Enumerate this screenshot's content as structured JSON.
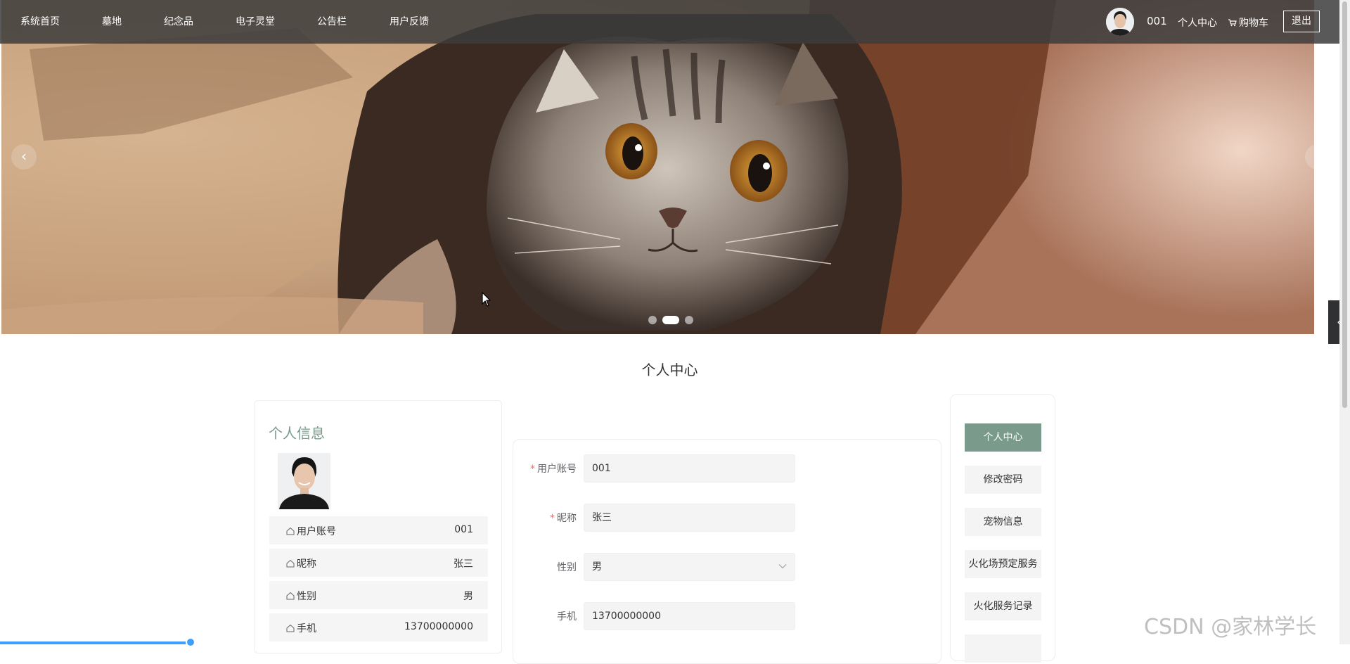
{
  "nav": {
    "items": [
      "系统首页",
      "墓地",
      "纪念品",
      "电子灵堂",
      "公告栏",
      "用户反馈"
    ],
    "username": "001",
    "personal_center": "个人中心",
    "cart": "购物车",
    "logout": "退出"
  },
  "banner": {
    "prev": "‹",
    "next": "›",
    "active_slide": 2,
    "slide_count": 3
  },
  "section_title": "个人中心",
  "info": {
    "title": "个人信息",
    "rows": [
      {
        "label": "用户账号",
        "value": "001"
      },
      {
        "label": "昵称",
        "value": "张三"
      },
      {
        "label": "性别",
        "value": "男"
      },
      {
        "label": "手机",
        "value": "13700000000"
      }
    ]
  },
  "form": {
    "fields": [
      {
        "label": "用户账号",
        "value": "001",
        "required": true
      },
      {
        "label": "昵称",
        "value": "张三",
        "required": true
      },
      {
        "label": "性别",
        "value": "男",
        "required": false
      },
      {
        "label": "手机",
        "value": "13700000000",
        "required": false
      }
    ]
  },
  "menu": {
    "items": [
      "个人中心",
      "修改密码",
      "宠物信息",
      "火化场预定服务",
      "火化服务记录"
    ],
    "active": 0
  },
  "side_tab": "‹",
  "watermark": "CSDN @家林学长",
  "colors": {
    "accent": "#7a9a8c",
    "nav_bg": "#3c3c3c",
    "required": "#f56c6c",
    "progress": "#409eff"
  }
}
